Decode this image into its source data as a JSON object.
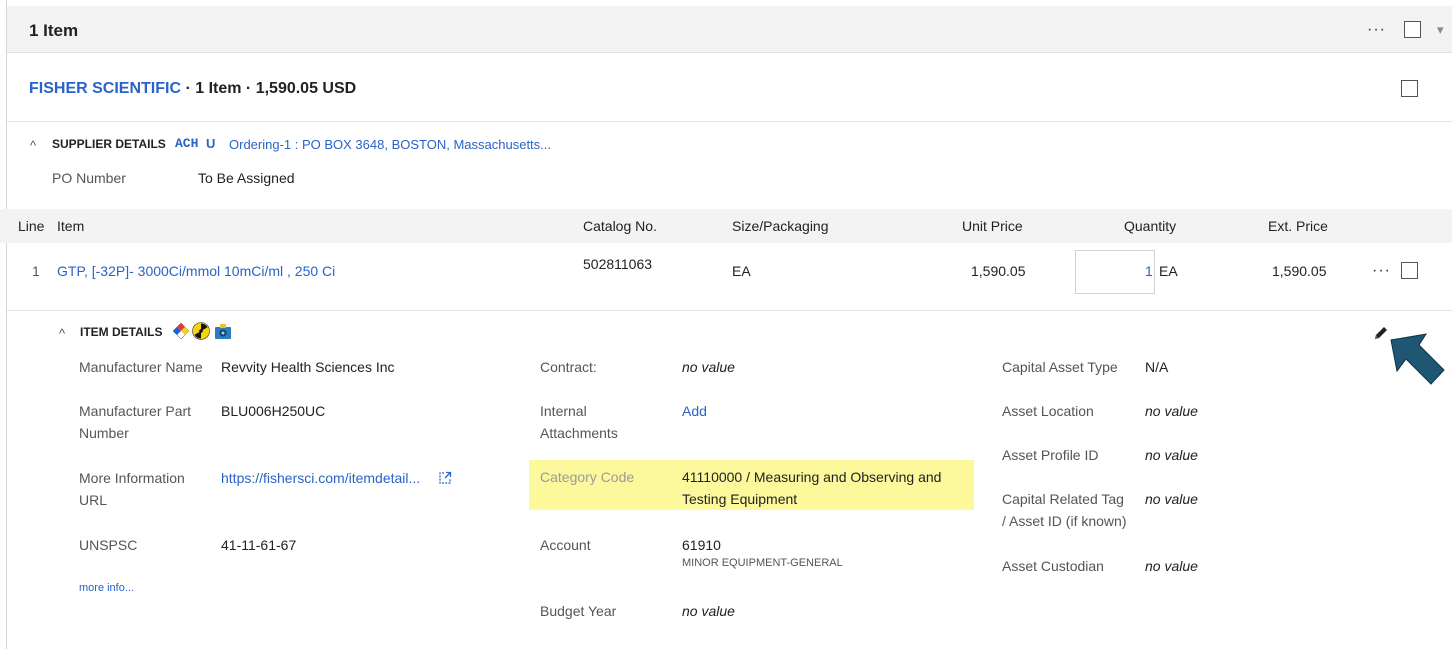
{
  "header": {
    "title": "1 Item",
    "more": "···",
    "dropdown": "▾"
  },
  "supplier": {
    "name": "FISHER SCIENTIFIC",
    "summary": " · 1 Item · 1,590.05 USD"
  },
  "supplier_details": {
    "toggle": "^",
    "label": "SUPPLIER DETAILS",
    "badge_ach": "ACH",
    "badge_u": "U",
    "address": "Ordering-1 : PO BOX 3648, BOSTON, Massachusetts...",
    "po_label": "PO Number",
    "po_value": "To Be Assigned"
  },
  "columns": [
    "Line",
    "Item",
    "Catalog No.",
    "Size/Packaging",
    "Unit Price",
    "Quantity",
    "Ext. Price"
  ],
  "row": {
    "line": "1",
    "item": "GTP, [-32P]- 3000Ci/mmol 10mCi/ml , 250 Ci",
    "catalog": "502811063",
    "size": "EA",
    "unit_price": "1,590.05",
    "quantity": "1",
    "quantity_unit": "EA",
    "ext_price": "1,590.05",
    "more": "···"
  },
  "item_details": {
    "toggle": "^",
    "label": "ITEM DETAILS",
    "col1": {
      "manufacturer_name_label": "Manufacturer Name",
      "manufacturer_name": "Revvity Health Sciences Inc",
      "mpn_label_1": "Manufacturer Part",
      "mpn_label_2": "Number",
      "mpn": "BLU006H250UC",
      "url_label_1": "More Information",
      "url_label_2": "URL",
      "url": "https://fishersci.com/itemdetail...",
      "unspsc_label": "UNSPSC",
      "unspsc": "41-11-61-67",
      "more_info": "more info..."
    },
    "col2": {
      "contract_label": "Contract:",
      "contract": "no value",
      "attachments_label_1": "Internal",
      "attachments_label_2": "Attachments",
      "attachments": "Add",
      "category_label": "Category Code",
      "category_1": "41110000 / Measuring and Observing and",
      "category_2": "Testing Equipment",
      "account_label": "Account",
      "account": "61910",
      "account_desc": "MINOR EQUIPMENT-GENERAL",
      "budget_label": "Budget Year",
      "budget": "no value"
    },
    "col3": {
      "cat_label": "Capital Asset Type",
      "cat_value": "N/A",
      "loc_label": "Asset Location",
      "loc_value": "no value",
      "profile_label": "Asset Profile ID",
      "profile_value": "no value",
      "tag_label_1": "Capital Related Tag",
      "tag_label_2": "/ Asset ID (if known)",
      "tag_value": "no value",
      "custodian_label": "Asset Custodian",
      "custodian_value": "no value"
    }
  },
  "colors": {
    "link": "#2a63c8",
    "highlight": "#fbf99c",
    "arrow": "#1f5673"
  },
  "icons": [
    "hazard-diamond-icon",
    "radioactive-icon",
    "camera-icon",
    "pencil-icon",
    "arrow-icon",
    "external-link-icon"
  ]
}
